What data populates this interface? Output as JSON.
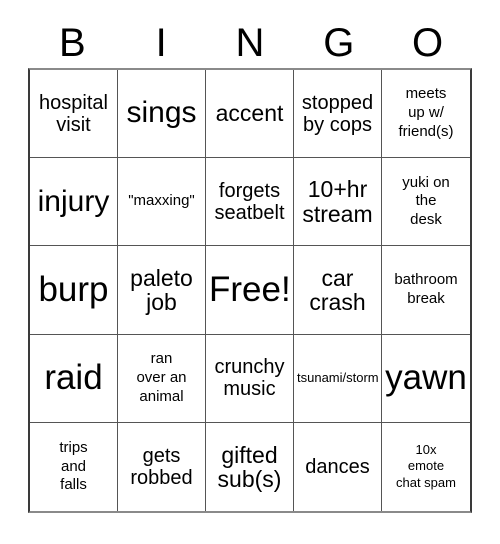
{
  "title": "BINGO",
  "header": {
    "letters": [
      "B",
      "I",
      "N",
      "G",
      "O"
    ]
  },
  "colors": {
    "background": "#ffffff",
    "text": "#000000",
    "grid_border": "#555555",
    "outer_border": "#3a3a3a"
  },
  "grid": {
    "rows": 5,
    "columns": 5,
    "free_space": {
      "row": 3,
      "column": 3,
      "label": "Free!"
    },
    "cells": [
      {
        "id": "b1",
        "text": "hospital\nvisit",
        "size": "sm"
      },
      {
        "id": "i1",
        "text": "sings",
        "size": "lg"
      },
      {
        "id": "n1",
        "text": "accent",
        "size": "md"
      },
      {
        "id": "g1",
        "text": "stopped\nby cops",
        "size": "sm"
      },
      {
        "id": "o1",
        "text": "meets\nup w/\nfriend(s)",
        "size": "xs"
      },
      {
        "id": "b2",
        "text": "injury",
        "size": "lg"
      },
      {
        "id": "i2",
        "text": "\"maxxing\"",
        "size": "xs"
      },
      {
        "id": "n2",
        "text": "forgets\nseatbelt",
        "size": "sm"
      },
      {
        "id": "g2",
        "text": "10+hr\nstream",
        "size": "md"
      },
      {
        "id": "o2",
        "text": "yuki on\nthe\ndesk",
        "size": "xs"
      },
      {
        "id": "b3",
        "text": "burp",
        "size": "xl"
      },
      {
        "id": "i3",
        "text": "paleto\njob",
        "size": "md"
      },
      {
        "id": "n3",
        "text": "Free!",
        "size": "xl"
      },
      {
        "id": "g3",
        "text": "car\ncrash",
        "size": "md"
      },
      {
        "id": "o3",
        "text": "bathroom\nbreak",
        "size": "xs"
      },
      {
        "id": "b4",
        "text": "raid",
        "size": "xl"
      },
      {
        "id": "i4",
        "text": "ran\nover an\nanimal",
        "size": "xs"
      },
      {
        "id": "n4",
        "text": "crunchy\nmusic",
        "size": "sm"
      },
      {
        "id": "g4",
        "text": "tsunami/storm",
        "size": "xxs"
      },
      {
        "id": "o4",
        "text": "yawn",
        "size": "xl"
      },
      {
        "id": "b5",
        "text": "trips\nand\nfalls",
        "size": "xs"
      },
      {
        "id": "i5",
        "text": "gets\nrobbed",
        "size": "sm"
      },
      {
        "id": "n5",
        "text": "gifted\nsub(s)",
        "size": "md"
      },
      {
        "id": "g5",
        "text": "dances",
        "size": "sm"
      },
      {
        "id": "o5",
        "text": "10x\nemote\nchat spam",
        "size": "xxs"
      }
    ]
  }
}
